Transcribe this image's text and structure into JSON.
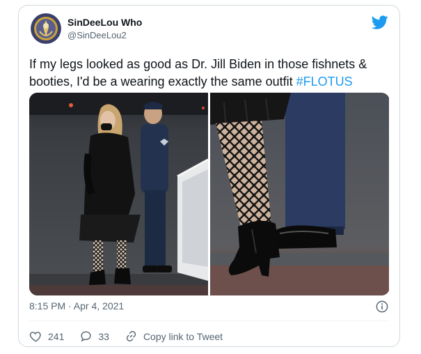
{
  "user": {
    "display_name": "SinDeeLou Who",
    "handle": "@SinDeeLou2"
  },
  "tweet": {
    "text_before": "If my legs looked as good as Dr. Jill Biden in those fishnets & booties, I'd be a wearing exactly the same outfit ",
    "hashtag": "#FLOTUS",
    "timestamp": "8:15 PM · Apr 4, 2021"
  },
  "photos": [
    {
      "alt": "Woman in black outfit, fishnet tights and boots walking beside uniformed officer near aircraft stairs"
    },
    {
      "alt": "Close-up of fishnet tights and black heeled booties next to officer's shoes"
    }
  ],
  "actions": {
    "likes": "241",
    "replies": "33",
    "copy_link": "Copy link to Tweet"
  },
  "icons": {
    "brand": "twitter-bird-icon",
    "info": "info-icon",
    "like": "heart-icon",
    "reply": "reply-icon",
    "link": "link-icon"
  },
  "colors": {
    "brand_blue": "#1d9bf0",
    "text_primary": "#0f1419",
    "text_secondary": "#536471",
    "border": "#cfd9de"
  }
}
